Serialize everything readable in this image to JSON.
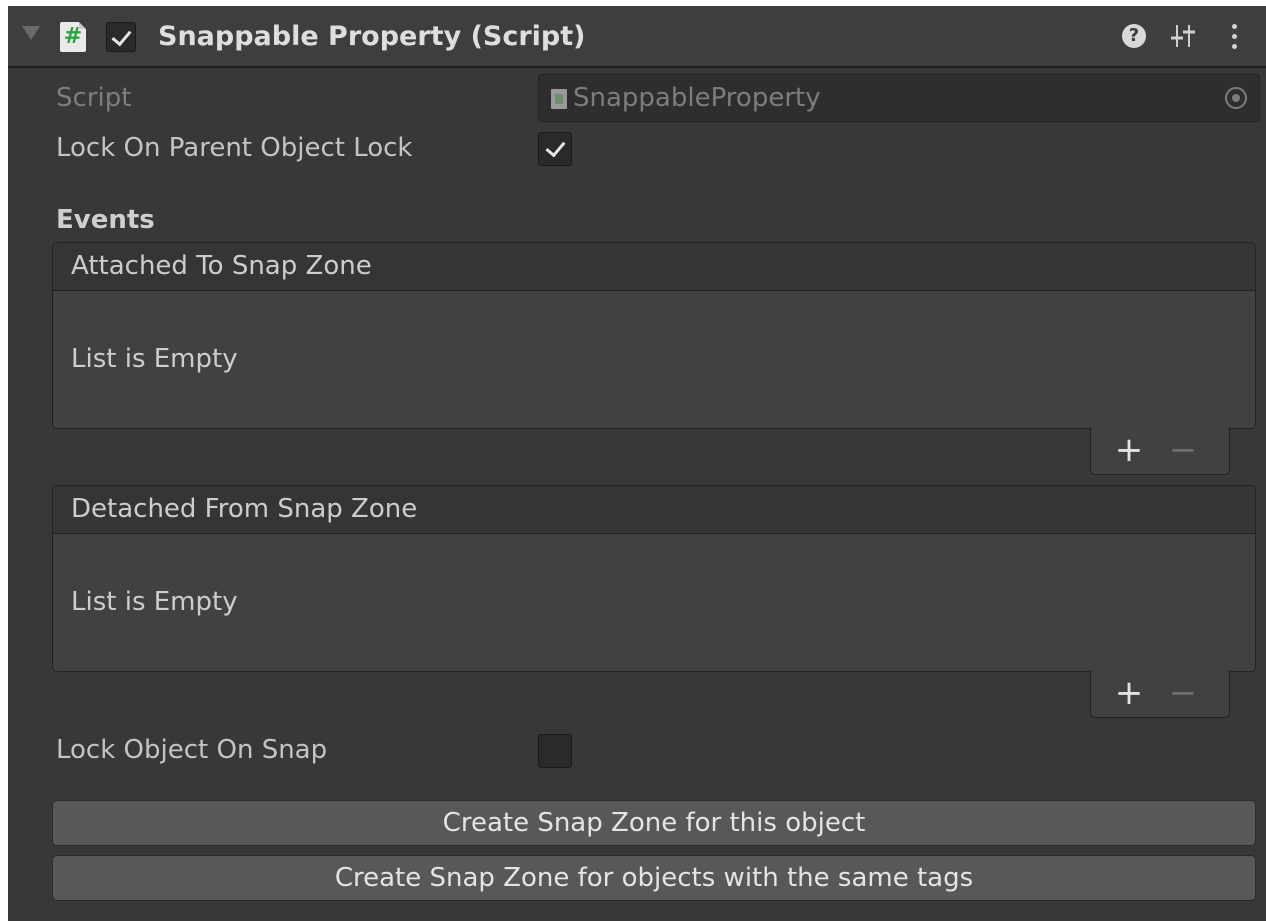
{
  "component": {
    "title": "Snappable Property (Script)",
    "script_icon_glyph": "#",
    "help_glyph": "?",
    "enabled": true
  },
  "fields": {
    "script_label": "Script",
    "script_value": "SnappableProperty",
    "lock_on_parent_label": "Lock On Parent Object Lock",
    "lock_on_parent_checked": true,
    "events_header": "Events",
    "lock_on_snap_label": "Lock Object On Snap",
    "lock_on_snap_checked": false
  },
  "events": [
    {
      "title": "Attached To Snap Zone",
      "empty_text": "List is Empty"
    },
    {
      "title": "Detached From Snap Zone",
      "empty_text": "List is Empty"
    }
  ],
  "list_controls": {
    "add": "+",
    "remove": "−"
  },
  "buttons": {
    "create_for_object": "Create Snap Zone for this object",
    "create_for_tags": "Create Snap Zone for objects with the same tags"
  },
  "icons": [
    "foldout-arrow-icon",
    "script-icon",
    "help-icon",
    "presets-icon",
    "more-icon",
    "object-picker-icon"
  ],
  "colors": {
    "panel_bg": "#383838",
    "header_bg": "#3e3e3e",
    "button_bg": "#585858",
    "script_icon_accent": "#30a040"
  }
}
